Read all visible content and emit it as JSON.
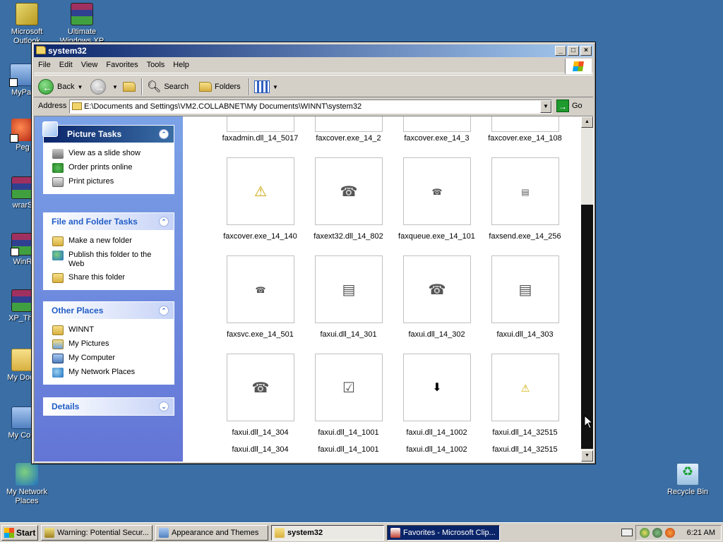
{
  "desktop": {
    "icons": [
      {
        "label": "Microsoft Outlook"
      },
      {
        "label": "Ultimate Windows XP"
      },
      {
        "label": "MyPa"
      },
      {
        "label": "Peg"
      },
      {
        "label": "wrarS"
      },
      {
        "label": "WinR"
      },
      {
        "label": "XP_The"
      },
      {
        "label": "My Docu"
      },
      {
        "label": "My Com"
      },
      {
        "label": "My Network Places"
      },
      {
        "label": "Recycle Bin"
      }
    ]
  },
  "window": {
    "title": "system32",
    "menu": [
      "File",
      "Edit",
      "View",
      "Favorites",
      "Tools",
      "Help"
    ],
    "toolbar": {
      "back": "Back",
      "search": "Search",
      "folders": "Folders"
    },
    "address": {
      "label": "Address",
      "value": "E:\\Documents and Settings\\VM2.COLLABNET\\My Documents\\WINNT\\system32",
      "go": "Go"
    },
    "taskpane": {
      "picture_tasks": {
        "title": "Picture Tasks",
        "items": [
          "View as a slide show",
          "Order prints online",
          "Print pictures"
        ]
      },
      "file_folder_tasks": {
        "title": "File and Folder Tasks",
        "items": [
          "Make a new folder",
          "Publish this folder to the Web",
          "Share this folder"
        ]
      },
      "other_places": {
        "title": "Other Places",
        "items": [
          "WINNT",
          "My Pictures",
          "My Computer",
          "My Network Places"
        ]
      },
      "details": {
        "title": "Details"
      }
    },
    "files": [
      {
        "name": "faxadmin.dll_14_5017"
      },
      {
        "name": "faxcover.exe_14_2"
      },
      {
        "name": "faxcover.exe_14_3"
      },
      {
        "name": "faxcover.exe_14_108"
      },
      {
        "name": "faxcover.exe_14_140"
      },
      {
        "name": "faxext32.dll_14_802"
      },
      {
        "name": "faxqueue.exe_14_101"
      },
      {
        "name": "faxsend.exe_14_256"
      },
      {
        "name": "faxsvc.exe_14_501"
      },
      {
        "name": "faxui.dll_14_301"
      },
      {
        "name": "faxui.dll_14_302"
      },
      {
        "name": "faxui.dll_14_303"
      },
      {
        "name": "faxui.dll_14_304"
      },
      {
        "name": "faxui.dll_14_1001"
      },
      {
        "name": "faxui.dll_14_1002"
      },
      {
        "name": "faxui.dll_14_32515"
      },
      {
        "name": "faxui.dll_14_304"
      },
      {
        "name": "faxui.dll_14_1001"
      },
      {
        "name": "faxui.dll_14_1002"
      },
      {
        "name": "faxui.dll_14_32515"
      }
    ]
  },
  "taskbar": {
    "start": "Start",
    "tasks": [
      "Warning: Potential Secur...",
      "Appearance and Themes",
      "system32",
      "Favorites - Microsoft Clip..."
    ],
    "clock": "6:21 AM"
  }
}
